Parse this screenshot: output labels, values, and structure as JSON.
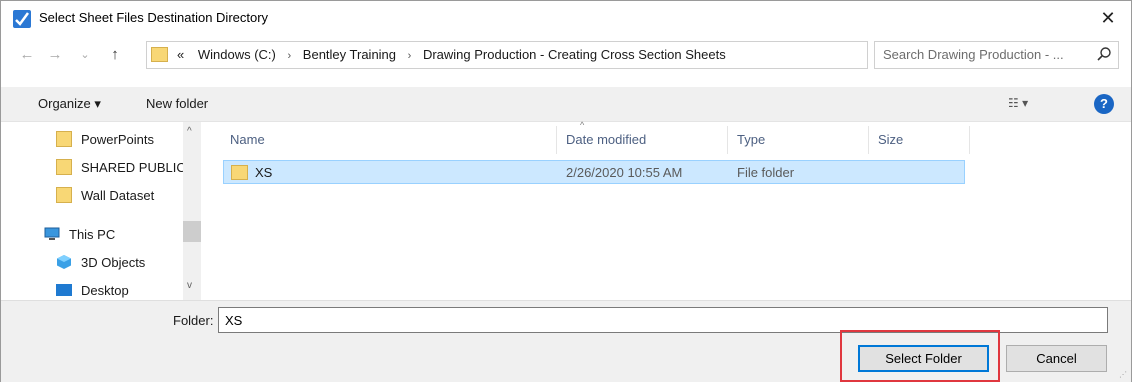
{
  "window": {
    "title": "Select Sheet Files Destination Directory",
    "close_symbol": "✕"
  },
  "nav_buttons": {
    "back": "←",
    "forward": "→",
    "recent": "⌄",
    "up": "↑"
  },
  "address": {
    "overflow": "«",
    "crumbs": [
      "Windows (C:)",
      "Bentley Training",
      "Drawing Production - Creating Cross Section Sheets"
    ],
    "separator": "›",
    "dropdown": "⌄",
    "refresh": "↻"
  },
  "search": {
    "placeholder": "Search Drawing Production - ..."
  },
  "toolbar": {
    "organize_label": "Organize ▾",
    "new_folder_label": "New folder",
    "view_label": "☷ ▾",
    "help_label": "?"
  },
  "nav_pane": {
    "items": [
      {
        "label": "PowerPoints",
        "icon": "folder-icon"
      },
      {
        "label": "SHARED PUBLIC",
        "icon": "folder-icon"
      },
      {
        "label": "Wall Dataset",
        "icon": "folder-icon"
      },
      {
        "label": "This PC",
        "icon": "computer-icon"
      },
      {
        "label": "3D Objects",
        "icon": "cube-icon"
      },
      {
        "label": "Desktop",
        "icon": "desktop-icon"
      }
    ],
    "scroll_up": "^",
    "scroll_down": "v"
  },
  "columns": {
    "name": "Name",
    "date": "Date modified",
    "type": "Type",
    "size": "Size",
    "sort_indicator": "^"
  },
  "files": [
    {
      "name": "XS",
      "date": "2/26/2020 10:55 AM",
      "type": "File folder",
      "size": ""
    }
  ],
  "footer": {
    "folder_label": "Folder:",
    "folder_value": "XS",
    "select_button": "Select Folder",
    "cancel_button": "Cancel",
    "grip": "⋰"
  },
  "colors": {
    "accent": "#0078d7",
    "selection_bg": "#cce8ff",
    "highlight_box": "#e0373f",
    "folder_yellow": "#f8d775",
    "help_blue": "#1a66c4"
  }
}
